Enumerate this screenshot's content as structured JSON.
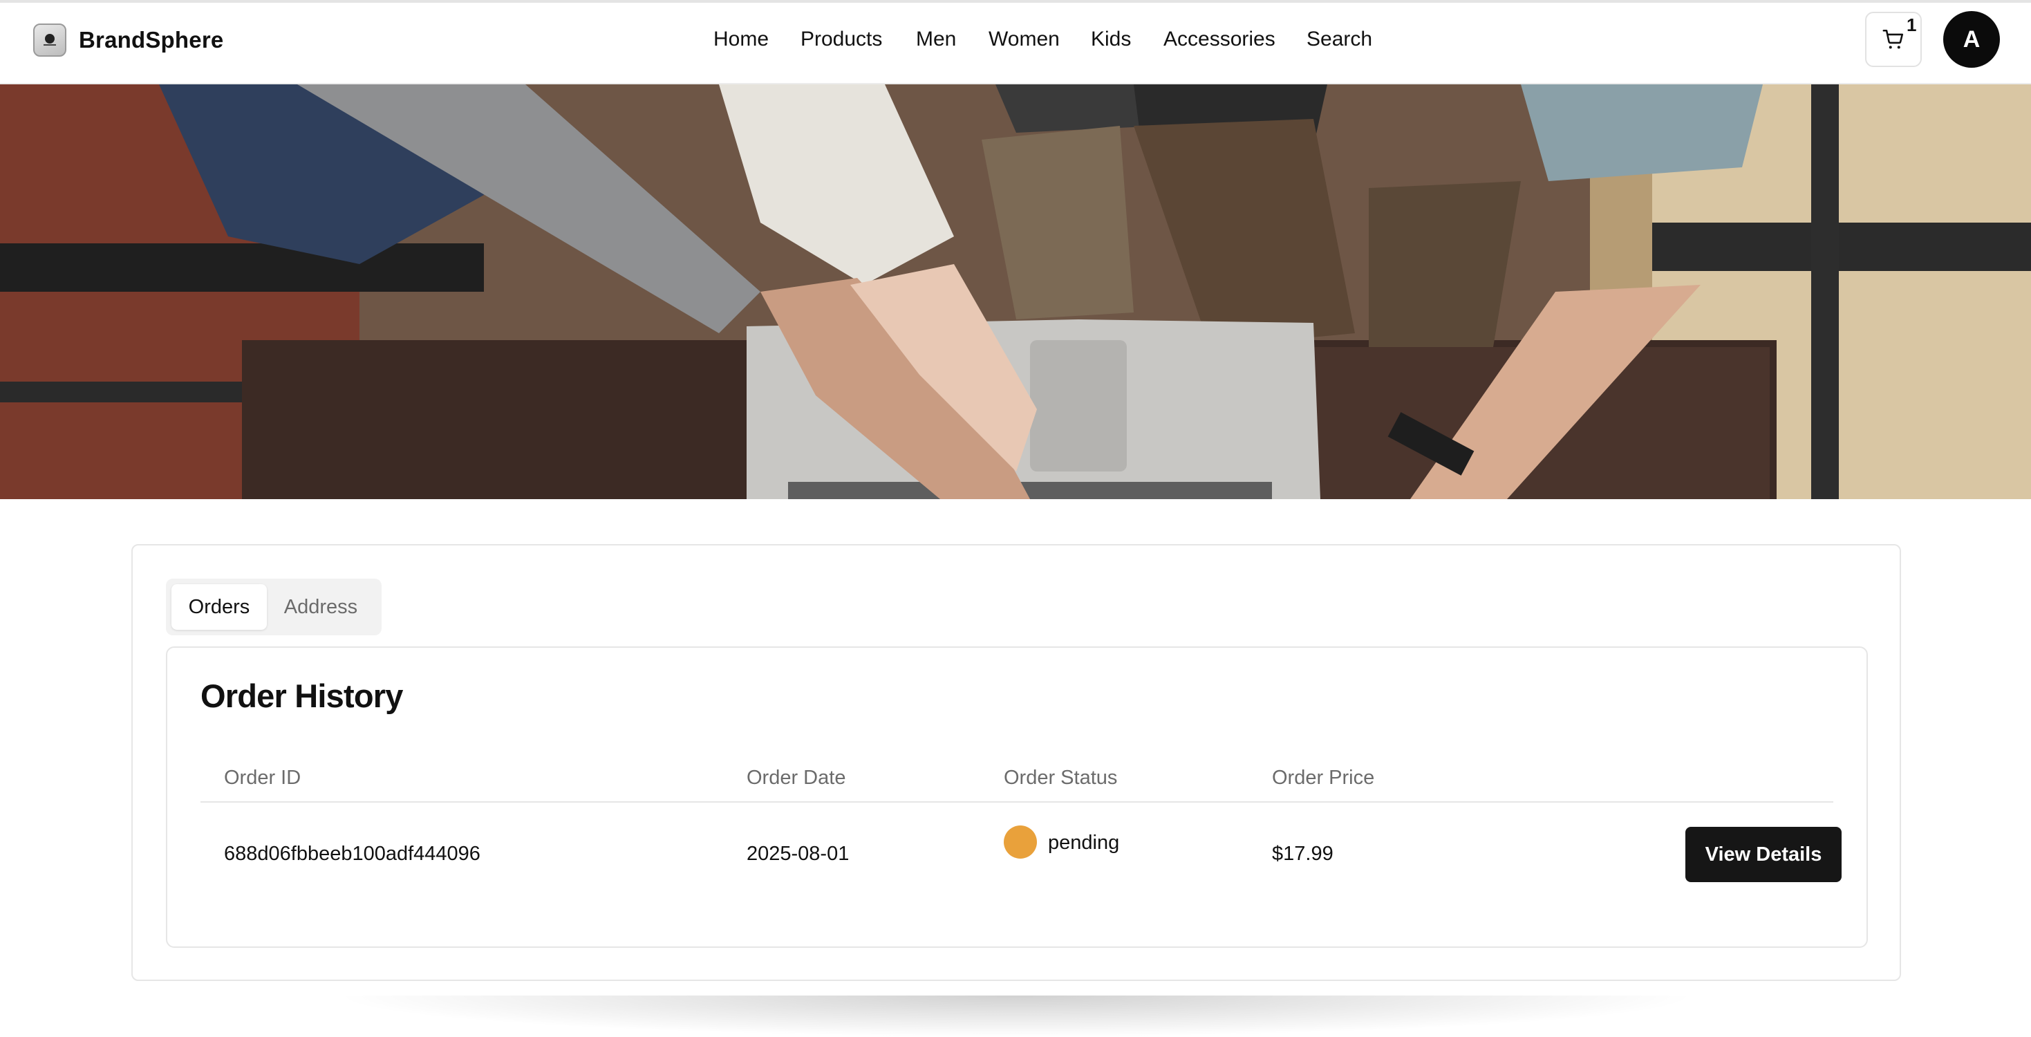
{
  "brand": {
    "name": "BrandSphere",
    "logo_icon": "globe-logo-icon"
  },
  "nav": {
    "items": [
      {
        "label": "Home"
      },
      {
        "label": "Products"
      },
      {
        "label": "Men"
      },
      {
        "label": "Women"
      },
      {
        "label": "Kids"
      },
      {
        "label": "Accessories"
      },
      {
        "label": "Search"
      }
    ]
  },
  "cart": {
    "icon": "shopping-cart-icon",
    "count": "1"
  },
  "user": {
    "avatar_initial": "A"
  },
  "hero": {
    "image": "overhead photo of people's hands on a laptop with shoes and rug"
  },
  "tabs": [
    {
      "label": "Orders",
      "active": true
    },
    {
      "label": "Address",
      "active": false
    }
  ],
  "orders": {
    "title": "Order History",
    "columns": [
      "Order ID",
      "Order Date",
      "Order Status",
      "Order Price"
    ],
    "rows": [
      {
        "id": "688d06fbbeeb100adf444096",
        "date": "2025-08-01",
        "status": "pending",
        "status_color": "#e9a13b",
        "price": "$17.99",
        "action_label": "View Details"
      }
    ]
  },
  "colors": {
    "primary_button": "#161616",
    "pending_status": "#e9a13b",
    "muted_text": "#6b6b6b"
  }
}
